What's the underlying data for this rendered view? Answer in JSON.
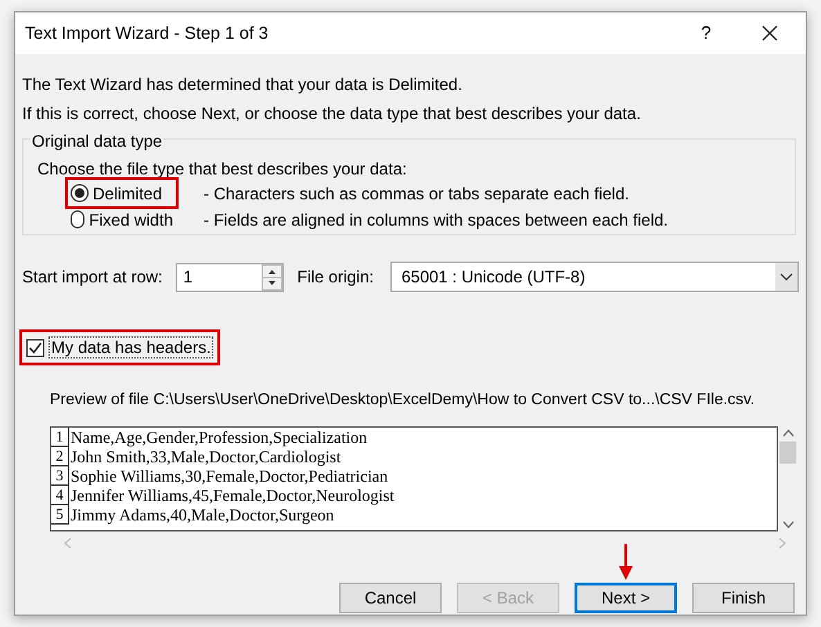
{
  "window": {
    "title": "Text Import Wizard - Step 1 of 3",
    "help": "?"
  },
  "intro": [
    "The Text Wizard has determined that your data is Delimited.",
    "If this is correct, choose Next, or choose the data type that best describes your data."
  ],
  "group": {
    "title": "Original data type",
    "prompt": "Choose the file type that best describes your data:",
    "options": [
      {
        "label": "Delimited",
        "description": "- Characters such as commas or tabs separate each field.",
        "selected": true,
        "highlighted": true
      },
      {
        "label": "Fixed width",
        "description": "- Fields are aligned in columns with spaces between each field.",
        "selected": false,
        "highlighted": false
      }
    ]
  },
  "start_row": {
    "label": "Start import at row:",
    "value": "1"
  },
  "file_origin": {
    "label": "File origin:",
    "value": "65001 : Unicode (UTF-8)"
  },
  "headers": {
    "label": "My data has headers.",
    "checked": true,
    "highlighted": true
  },
  "preview": {
    "label": "Preview of file C:\\Users\\User\\OneDrive\\Desktop\\ExcelDemy\\How to Convert CSV to...\\CSV FIle.csv.",
    "rows": [
      {
        "number": "1",
        "text": "Name,Age,Gender,Profession,Specialization"
      },
      {
        "number": "2",
        "text": "John Smith,33,Male,Doctor,Cardiologist"
      },
      {
        "number": "3",
        "text": "Sophie Williams,30,Female,Doctor,Pediatrician"
      },
      {
        "number": "4",
        "text": "Jennifer Williams,45,Female,Doctor,Neurologist"
      },
      {
        "number": "5",
        "text": "Jimmy Adams,40,Male,Doctor,Surgeon"
      }
    ]
  },
  "buttons": [
    {
      "label": "Cancel",
      "disabled": false,
      "default": false,
      "annotated": false
    },
    {
      "label": "< Back",
      "disabled": true,
      "default": false,
      "annotated": false
    },
    {
      "label": "Next >",
      "disabled": false,
      "default": true,
      "annotated": true
    },
    {
      "label": "Finish",
      "disabled": false,
      "default": false,
      "annotated": false
    }
  ]
}
